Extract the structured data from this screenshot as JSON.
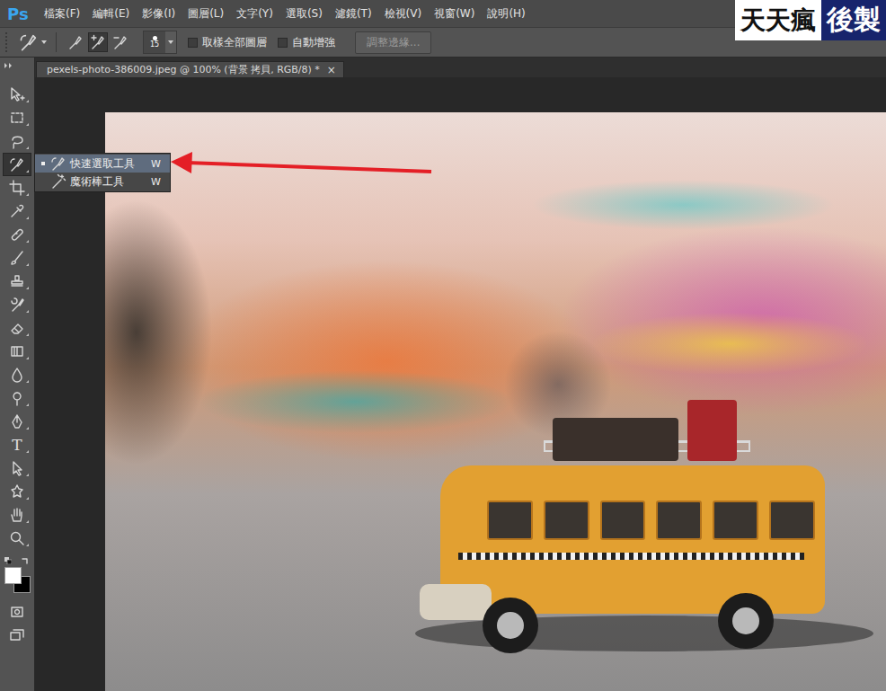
{
  "app": {
    "logo": "Ps"
  },
  "menu": [
    "檔案(F)",
    "編輯(E)",
    "影像(I)",
    "圖層(L)",
    "文字(Y)",
    "選取(S)",
    "濾鏡(T)",
    "檢視(V)",
    "視窗(W)",
    "說明(H)"
  ],
  "watermark": {
    "left": "天天瘋",
    "right": "後製"
  },
  "options_bar": {
    "modes": [
      {
        "selected": false
      },
      {
        "selected": true
      },
      {
        "selected": false
      }
    ],
    "brush_size": "15",
    "checkboxes": [
      {
        "label": "取樣全部圖層",
        "checked": false
      },
      {
        "label": "自動增強",
        "checked": false
      }
    ],
    "button": {
      "label": "調整邊緣...",
      "disabled": true
    }
  },
  "document_tab": {
    "title": "pexels-photo-386009.jpeg @ 100% (背景 拷貝, RGB/8) *",
    "close": "×"
  },
  "tools": [
    {
      "selected": false
    },
    {
      "selected": false
    },
    {
      "selected": false
    },
    {
      "selected": true
    },
    {
      "selected": false
    },
    {
      "selected": false
    },
    {
      "selected": false
    },
    {
      "selected": false
    },
    {
      "selected": false
    },
    {
      "selected": false
    },
    {
      "selected": false
    },
    {
      "selected": false
    },
    {
      "selected": false
    },
    {
      "selected": false
    },
    {
      "selected": false
    },
    {
      "selected": false,
      "glyph": "T"
    },
    {
      "selected": false
    },
    {
      "selected": false
    },
    {
      "selected": false
    },
    {
      "selected": false
    }
  ],
  "colors": {
    "foreground": "#ffffff",
    "background": "#000000"
  },
  "flyout": [
    {
      "label": "快速選取工具",
      "shortcut": "W",
      "selected": true
    },
    {
      "label": "魔術棒工具",
      "shortcut": "W",
      "selected": false
    }
  ]
}
